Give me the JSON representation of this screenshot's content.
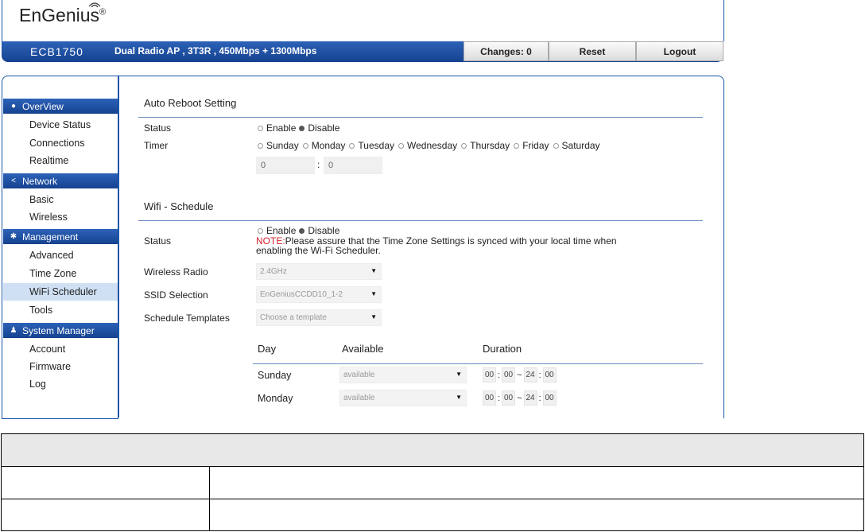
{
  "header": {
    "logo": "EnGenius",
    "logo_mark": "®",
    "model": "ECB1750",
    "description": "Dual Radio AP , 3T3R , 450Mbps + 1300Mbps",
    "changes_label": "Changes: 0",
    "reset_label": "Reset",
    "logout_label": "Logout"
  },
  "sidebar": {
    "sections": [
      {
        "title": "OverView",
        "icon": "info-icon",
        "items": [
          "Device Status",
          "Connections",
          "Realtime"
        ]
      },
      {
        "title": "Network",
        "icon": "share-icon",
        "items": [
          "Basic",
          "Wireless"
        ]
      },
      {
        "title": "Management",
        "icon": "gear-icon",
        "items": [
          "Advanced",
          "Time Zone",
          "WiFi Scheduler",
          "Tools"
        ]
      },
      {
        "title": "System Manager",
        "icon": "user-icon",
        "items": [
          "Account",
          "Firmware",
          "Log"
        ]
      }
    ],
    "active_item": "WiFi Scheduler"
  },
  "auto_reboot": {
    "title": "Auto Reboot Setting",
    "status_label": "Status",
    "enable_label": "Enable",
    "disable_label": "Disable",
    "selected": "Disable",
    "timer_label": "Timer",
    "days": [
      "Sunday",
      "Monday",
      "Tuesday",
      "Wednesday",
      "Thursday",
      "Friday",
      "Saturday"
    ],
    "hour_value": "0",
    "minute_value": "0",
    "time_sep": ":"
  },
  "wifi_schedule": {
    "title": "Wifi - Schedule",
    "status_label": "Status",
    "enable_label": "Enable",
    "disable_label": "Disable",
    "selected": "Disable",
    "note_prefix": "NOTE:",
    "note_text": "Please assure that the Time Zone Settings is synced with your local time when",
    "note_text2": "enabling the Wi-Fi Scheduler.",
    "wireless_radio_label": "Wireless Radio",
    "wireless_radio_value": "2.4GHz",
    "ssid_label": "SSID Selection",
    "ssid_value": "EnGeniusCCDD10_1-2",
    "templates_label": "Schedule Templates",
    "templates_value": "Choose a template",
    "col_day": "Day",
    "col_available": "Available",
    "col_duration": "Duration",
    "rows": [
      {
        "day": "Sunday",
        "available": "available",
        "start_h": "00",
        "start_m": "00",
        "end_h": "24",
        "end_m": "00"
      },
      {
        "day": "Monday",
        "available": "available",
        "start_h": "00",
        "start_m": "00",
        "end_h": "24",
        "end_m": "00"
      }
    ],
    "tilde": "~",
    "colon": ":"
  },
  "colors": {
    "accent": "#1a55a8",
    "active_bg": "#cfe0f4",
    "note_red": "#d0202a"
  }
}
